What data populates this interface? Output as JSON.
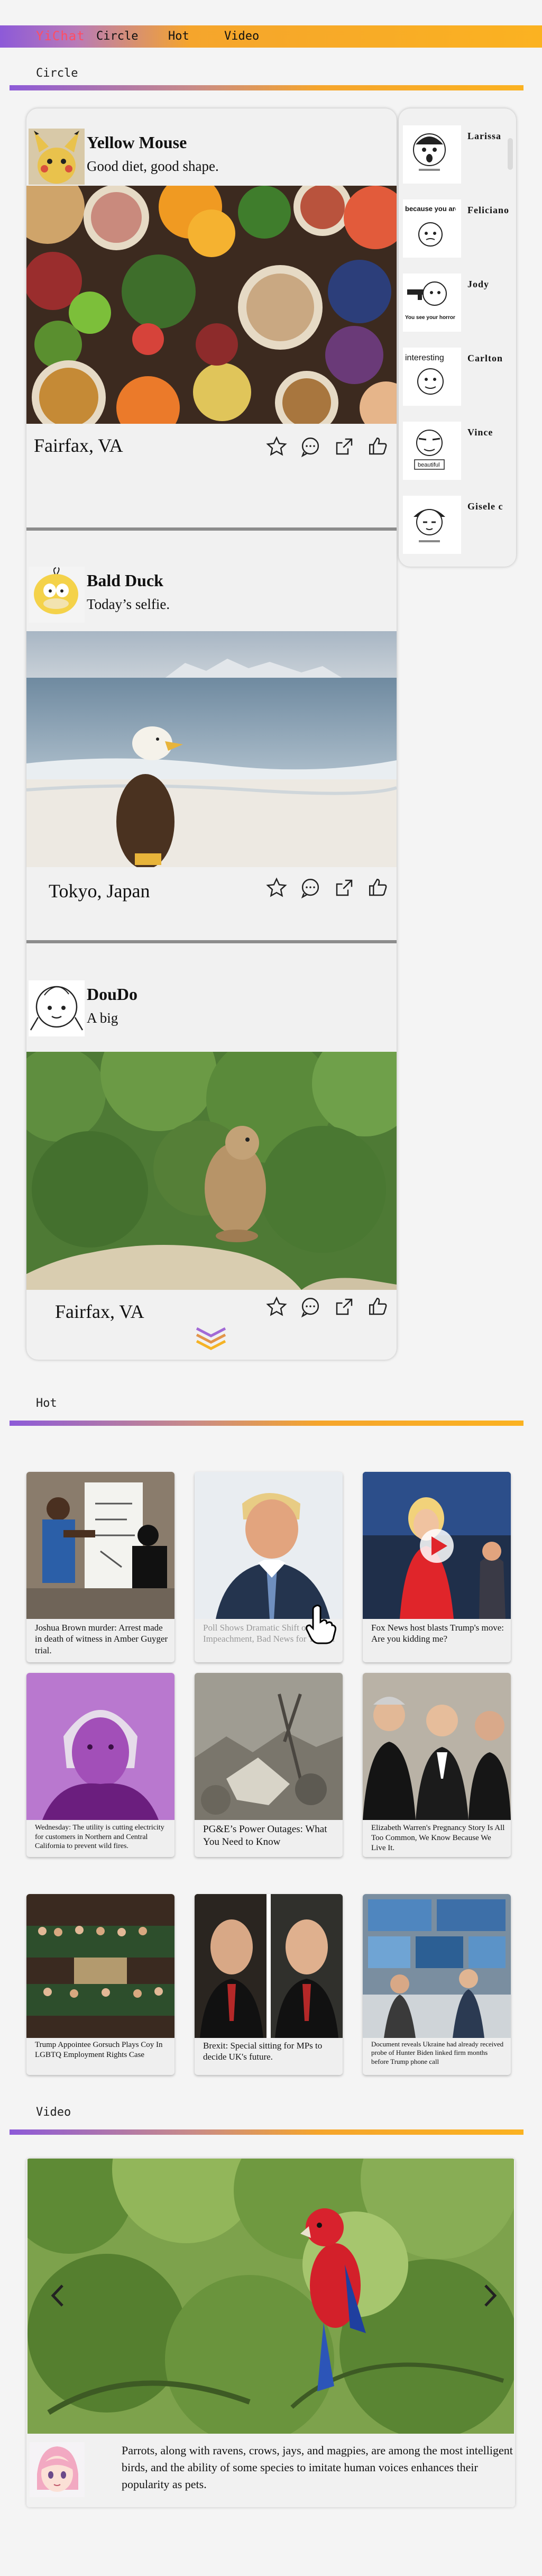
{
  "app": {
    "logo": "YiChat",
    "nav": [
      "Circle",
      "Hot",
      "Video"
    ]
  },
  "sections": {
    "circle": "Circle",
    "hot": "Hot",
    "video": "Video"
  },
  "posts": [
    {
      "name": "Yellow Mouse",
      "text": "Good diet, good shape.",
      "location": "Fairfax, VA",
      "image": "healthy-food",
      "avatar": "pikachu-avatar"
    },
    {
      "name": "Bald Duck",
      "text": "Today’s selfie.",
      "location": "Tokyo, Japan",
      "image": "bald-eagle-beach",
      "avatar": "psyduck-avatar"
    },
    {
      "name": "DouDo",
      "text": "A big",
      "location": "Fairfax, VA",
      "image": "ground-squirrel",
      "avatar": "doodle-avatar"
    }
  ],
  "friends": [
    {
      "name": "Larissa",
      "meme": "surprised-face-meme",
      "caption": ""
    },
    {
      "name": "Feliciano",
      "meme": "because-you-are-poor-meme",
      "caption": "because you are poor."
    },
    {
      "name": "Jody",
      "meme": "gun-meme",
      "caption": "You see your horror"
    },
    {
      "name": "Carlton",
      "meme": "interesting-meme",
      "caption": "interesting"
    },
    {
      "name": "Vince",
      "meme": "beautiful-meme",
      "caption": "beautiful"
    },
    {
      "name": "Gisele c",
      "meme": "sleeping-meme",
      "caption": ""
    }
  ],
  "news": [
    {
      "caption": "Joshua Brown murder: Arrest made in death of witness in Amber Guyger trial.",
      "image": "whiteboard-scene"
    },
    {
      "caption": "Poll Shows Dramatic Shift on Impeachment, Bad News for Trump.",
      "image": "trump-portrait",
      "faded": true
    },
    {
      "caption": "Fox News host blasts Trump's move: Are you kidding me?",
      "image": "news-anchor-video"
    },
    {
      "caption": "Wednesday: The utility is cutting electricity for customers in Northern and Central California to prevent wild fires.",
      "image": "purple-portrait"
    },
    {
      "caption": "PG&E’s Power Outages: What You Need to Know",
      "image": "fire-debris"
    },
    {
      "caption": "Elizabeth Warren's Pregnancy Story Is All Too Common, We Know Because We Live It.",
      "image": "judges-group"
    },
    {
      "caption": "Trump Appointee Gorsuch Plays Coy In LGBTQ Employment Rights Case",
      "image": "parliament-chamber"
    },
    {
      "caption": "Brexit: Special sitting for MPs to decide UK's future.",
      "image": "two-men-split"
    },
    {
      "caption": "Document reveals Ukraine had already received probe of Hunter Biden linked firm months before Trump phone call",
      "image": "newsroom-screens"
    }
  ],
  "video": {
    "caption": "Parrots, along with ravens, crows, jays, and magpies, are among the most intelligent birds, and the ability of some species to imitate human voices enhances their popularity as pets.",
    "image": "red-parrot",
    "avatar": "anime-girl-avatar"
  },
  "colors": {
    "logo": "#ff4d63",
    "accent_start": "#8d5ad8",
    "accent_end": "#fbb221"
  }
}
